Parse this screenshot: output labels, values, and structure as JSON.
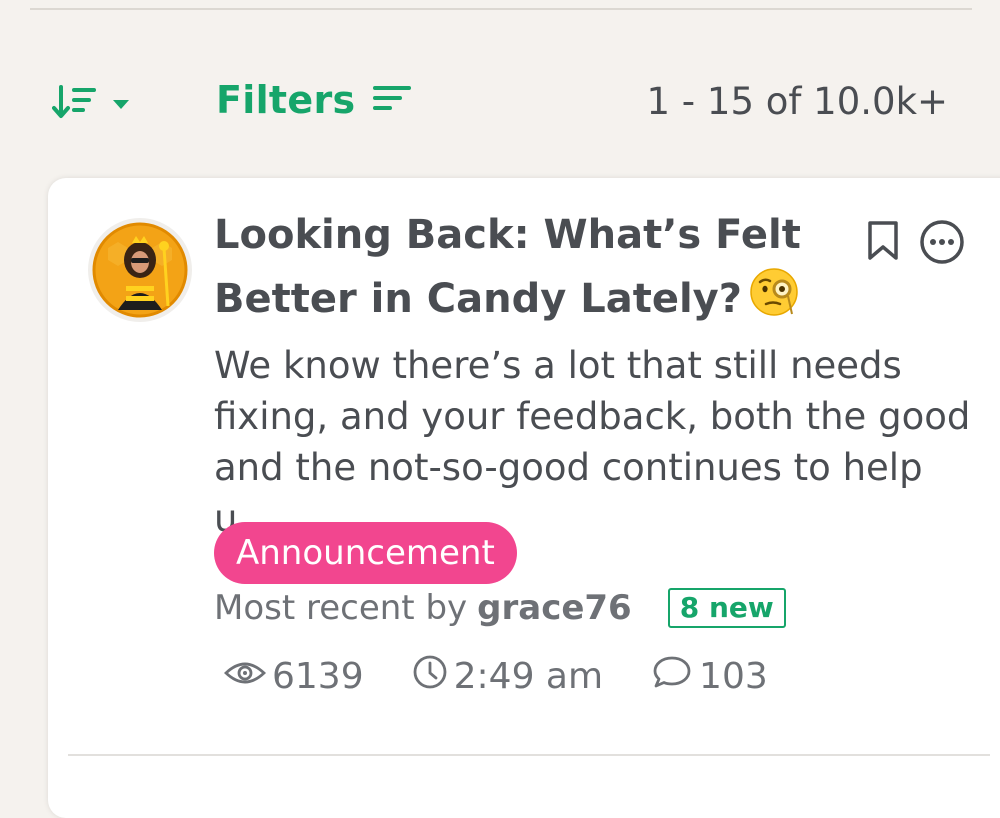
{
  "toolbar": {
    "sort_icon": "sort-descending-icon",
    "dropdown_icon": "caret-down-icon",
    "filters_label": "Filters",
    "filters_icon": "filter-lines-icon",
    "count": "1 - 15 of 10.0k+"
  },
  "post": {
    "title": "Looking Back: What’s Felt Better in Candy Lately?",
    "title_emoji": "face-with-monocle-emoji",
    "excerpt": "We know there’s a lot that still needs fixing, and your feedback, both the good and the not-so-good continues to help u...",
    "tag": "Announcement",
    "recent_prefix": "Most recent by",
    "author": "grace76",
    "new_badge": "8 new",
    "views": "6139",
    "time": "2:49 am",
    "comments": "103"
  },
  "colors": {
    "accent": "#16a56a",
    "tag": "#f2468f",
    "text": "#4a4d52",
    "muted": "#6e7176",
    "background": "#f5f2ee"
  }
}
